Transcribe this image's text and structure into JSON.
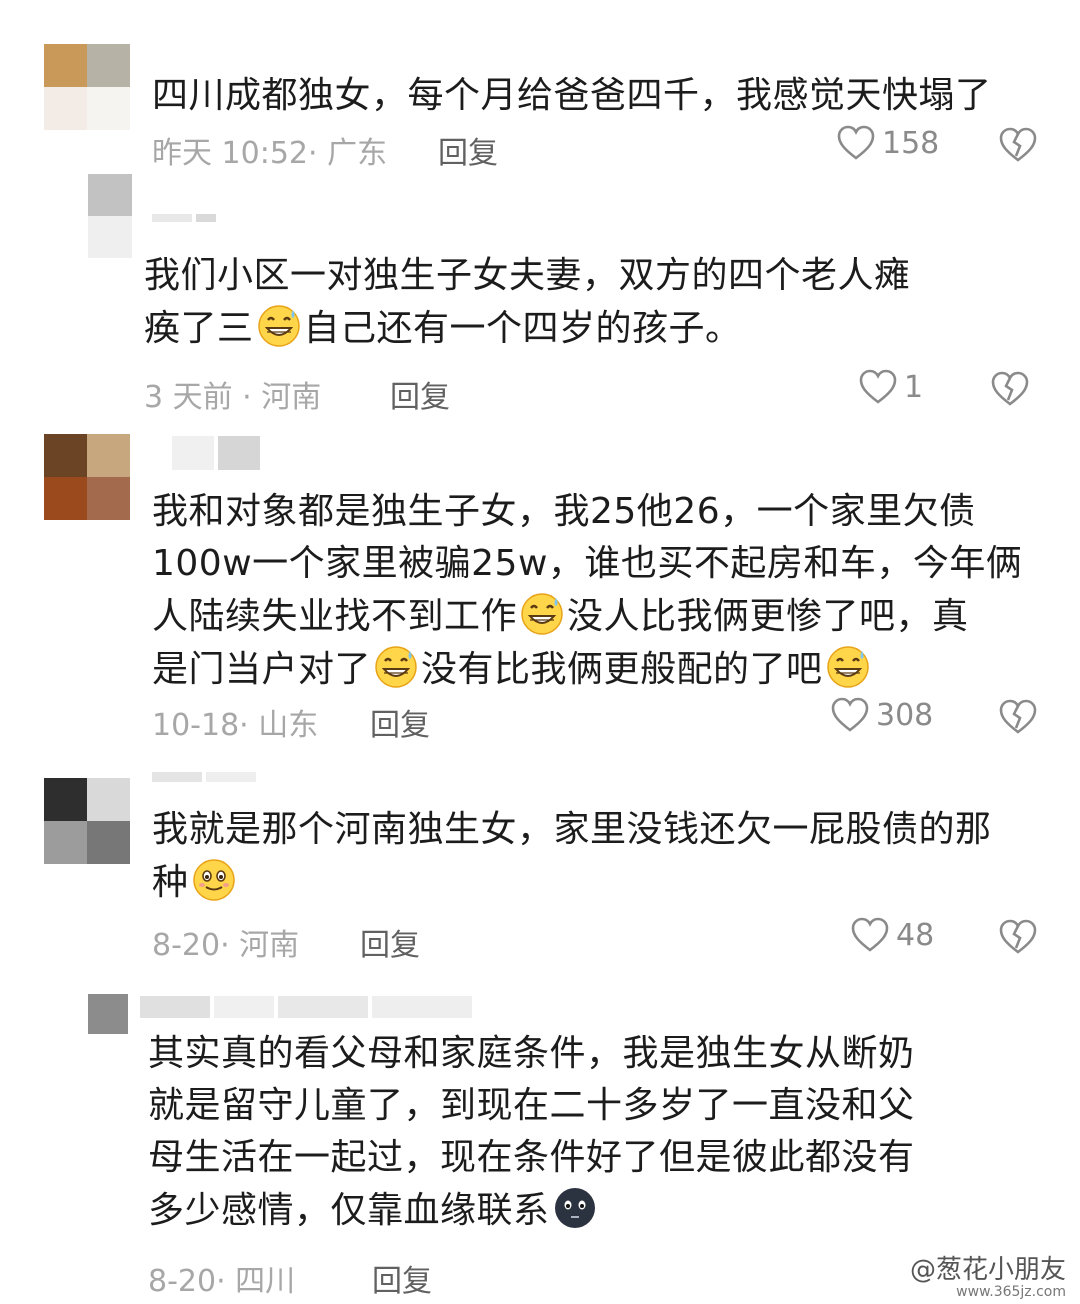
{
  "comments": [
    {
      "text": "四川成都独女，每个月给爸爸四千，我感觉天快塌了",
      "meta": "昨天 10:52· 广东",
      "reply": "回复",
      "likes": "158"
    },
    {
      "text_a": "我们小区一对独生子女夫妻，双方的四个老人瘫\n痪了三",
      "text_b": "自己还有一个四岁的孩子。",
      "emoji": "sweat-grin-emoji",
      "meta": "3 天前 · 河南",
      "reply": "回复",
      "likes": "1"
    },
    {
      "text_a": "我和对象都是独生子女，我25他26，一个家里欠债\n100w一个家里被骗25w，谁也买不起房和车，今年俩\n人陆续失业找不到工作",
      "text_b": "没人比我俩更惨了吧，真\n是门当户对了",
      "text_c": "没有比我俩更般配的了吧",
      "emoji": "sweat-grin-emoji",
      "meta": "10-18· 山东",
      "reply": "回复",
      "likes": "308"
    },
    {
      "text": "我就是那个河南独生女，家里没钱还欠一屁股债的那\n种",
      "emoji": "smile-emoji",
      "meta": "8-20· 河南",
      "reply": "回复",
      "likes": "48"
    },
    {
      "text": "其实真的看父母和家庭条件，我是独生女从断奶\n就是留守儿童了，到现在二十多岁了一直没和父\n母生活在一起过，现在条件好了但是彼此都没有\n多少感情，仅靠血缘联系",
      "emoji": "dark-face-emoji",
      "meta": "8-20· 四川",
      "reply": "回复"
    }
  ],
  "watermark": {
    "name": "@葱花小朋友",
    "site": "www.365jz.com"
  },
  "colors": {
    "text": "#1c1c1c",
    "meta": "#a7a7a7",
    "reply": "#616161",
    "icon": "#8a8a8a"
  }
}
